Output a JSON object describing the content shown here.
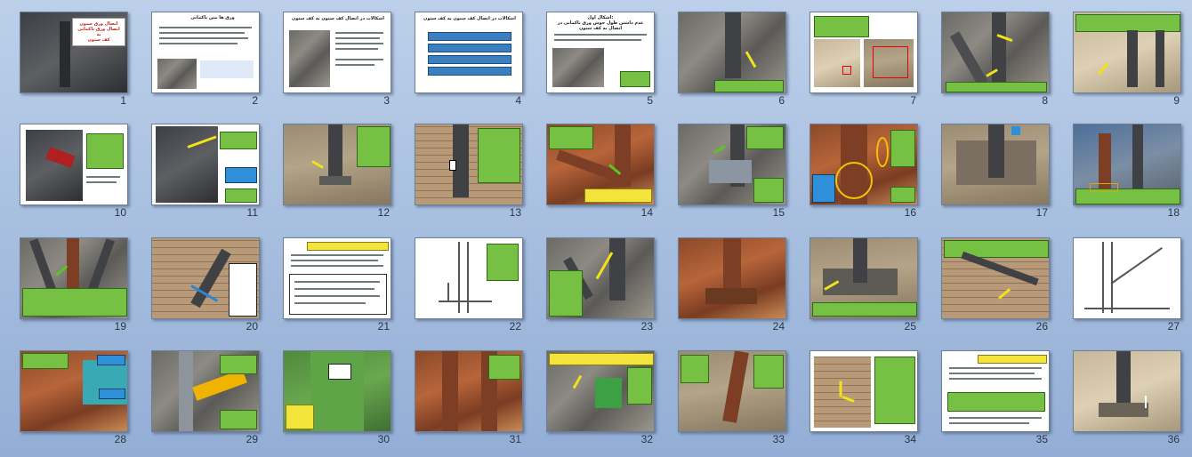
{
  "view": "slide-sorter",
  "slides": [
    {
      "n": "1",
      "heading": "اتصال ورق ستون\nاتصال ورق باکمانی به\nکف ستون"
    },
    {
      "n": "2",
      "heading": "ورق ها متن باکمانی"
    },
    {
      "n": "3",
      "heading": "اشکالات در اتصال کف ستون به کف ستون"
    },
    {
      "n": "4",
      "heading": "اشکالات در اتصال کف ستون به کف ستون"
    },
    {
      "n": "5",
      "heading": "اشکال اول:\nعدم داشتن طول جوش ورق باکمانی در اتصال به کف ستون"
    },
    {
      "n": "6",
      "heading": ""
    },
    {
      "n": "7",
      "heading": ""
    },
    {
      "n": "8",
      "heading": ""
    },
    {
      "n": "9",
      "heading": ""
    },
    {
      "n": "10",
      "heading": ""
    },
    {
      "n": "11",
      "heading": ""
    },
    {
      "n": "12",
      "heading": ""
    },
    {
      "n": "13",
      "heading": ""
    },
    {
      "n": "14",
      "heading": ""
    },
    {
      "n": "15",
      "heading": ""
    },
    {
      "n": "16",
      "heading": ""
    },
    {
      "n": "17",
      "heading": ""
    },
    {
      "n": "18",
      "heading": ""
    },
    {
      "n": "19",
      "heading": ""
    },
    {
      "n": "20",
      "heading": ""
    },
    {
      "n": "21",
      "heading": ""
    },
    {
      "n": "22",
      "heading": ""
    },
    {
      "n": "23",
      "heading": ""
    },
    {
      "n": "24",
      "heading": ""
    },
    {
      "n": "25",
      "heading": ""
    },
    {
      "n": "26",
      "heading": ""
    },
    {
      "n": "27",
      "heading": ""
    },
    {
      "n": "28",
      "heading": ""
    },
    {
      "n": "29",
      "heading": ""
    },
    {
      "n": "30",
      "heading": ""
    },
    {
      "n": "31",
      "heading": ""
    },
    {
      "n": "32",
      "heading": ""
    },
    {
      "n": "33",
      "heading": ""
    },
    {
      "n": "34",
      "heading": ""
    },
    {
      "n": "35",
      "heading": ""
    },
    {
      "n": "36",
      "heading": ""
    }
  ]
}
